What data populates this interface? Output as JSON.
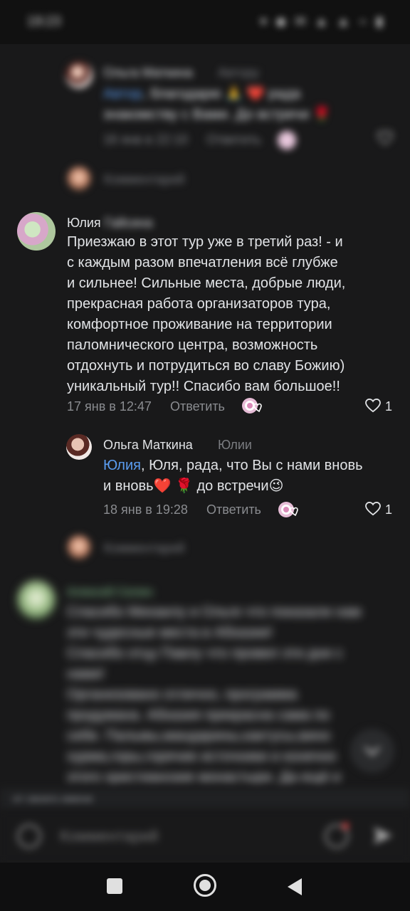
{
  "statusbar": {
    "time": "19:23",
    "icons": "▾ ◆ ✉ ▲ ▲ ⌁ ▮"
  },
  "thread": {
    "top_reply": {
      "author": "Ольга Маткина",
      "to": "Автору",
      "mention": "Автор",
      "text_line1": ", благодарю 🙏 ❤️ рада",
      "text_line2": "знакомству с Вами. До встречи 🌹",
      "date": "16 янв в 22:10",
      "reply_label": "Ответить"
    },
    "comment_placeholder_1": "Комментарий",
    "main_comment": {
      "author_first": "Юлия",
      "author_last": "Гайсина",
      "lines": [
        "Приезжаю в этот тур уже в третий раз! - и",
        "с каждым разом впечатления всё глубже",
        "и сильнее! Сильные места, добрые люди,",
        "прекрасная работа  организаторов тура,",
        "комфортное проживание на территории",
        "паломнического центра, возможность",
        "отдохнуть и потрудиться во славу Божию)",
        "уникальный тур!! Спасибо вам большое!!"
      ],
      "date": "17 янв в 12:47",
      "reply_label": "Ответить",
      "likes": "1"
    },
    "reply": {
      "author": "Ольга Маткина",
      "to": "Юлии",
      "mention": "Юлия",
      "line1_rest": ", Юля, рада, что Вы с нами вновь",
      "line2": "и вновь❤️ 🌹 до встречи😉",
      "date": "18 янв в 19:28",
      "reply_label": "Ответить",
      "likes": "1"
    },
    "comment_placeholder_2": "Комментарий",
    "next_comment": {
      "author": "Алексей Селин",
      "lines": [
        "Спасибо Михаилу и Ольге что показали нам",
        "эти чудесные места в Абхазии!",
        "Спасибо отцу Павлу что провел эти дни с",
        "нами!",
        "Организовано отлично, программа",
        "продумана. Абхазия прекрасна сама по",
        "себе. Пальмы,мандарины,кактусы,вино",
        "хурма,горы,горячие источники и конечно",
        "этого христианские монастыри. Да ещё и"
      ]
    }
  },
  "bottom": {
    "reply_target": "от своего имени",
    "input_placeholder": "Комментарий"
  }
}
